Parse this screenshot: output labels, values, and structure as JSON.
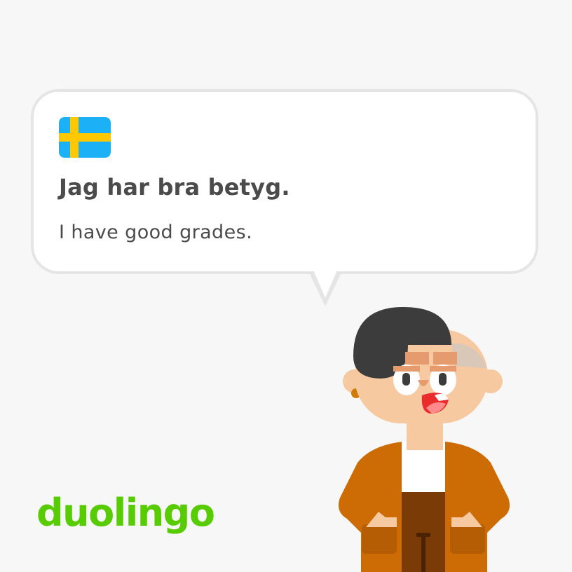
{
  "card": {
    "phrase": "Jag har bra betyg.",
    "translation": "I have good grades."
  },
  "flag": {
    "icon": "sweden-flag-icon",
    "field_color": "#1cb0f6",
    "cross_color": "#ffc800"
  },
  "brand": {
    "logo_text": "duolingo",
    "logo_color": "#58cc02"
  },
  "character": {
    "icon": "duolingo-character-illustration"
  }
}
